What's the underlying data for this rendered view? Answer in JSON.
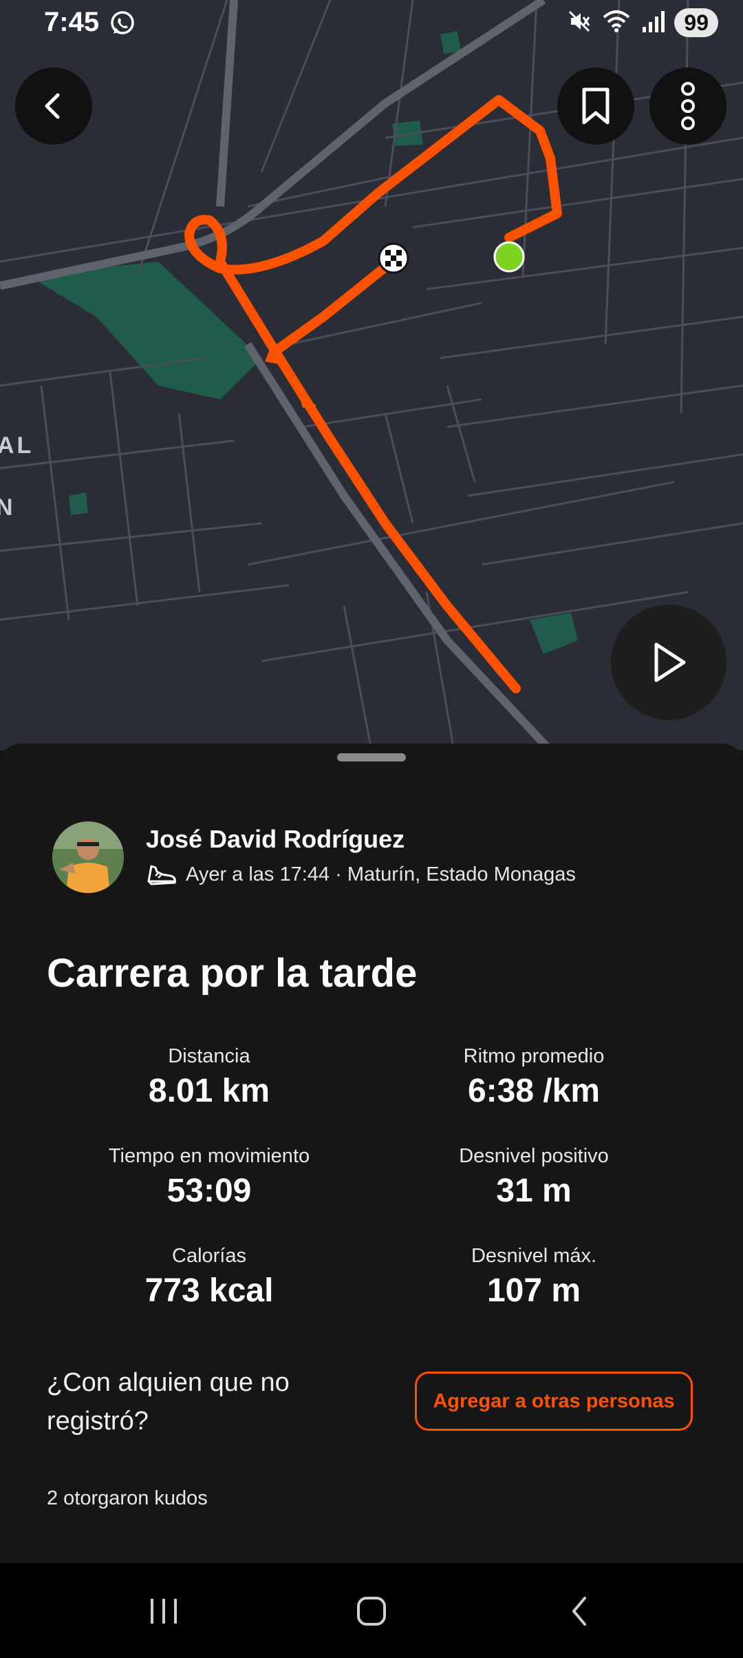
{
  "status_bar": {
    "time": "7:45",
    "battery": "99",
    "icons": [
      "whatsapp-icon",
      "mute-icon",
      "wifi-icon",
      "signal-icon"
    ]
  },
  "map": {
    "labels": [
      "AL",
      "N"
    ],
    "route_color": "#fc5200",
    "start_color": "#7ed321",
    "buttons": [
      "back-icon",
      "bookmark-icon",
      "more-icon",
      "play-icon"
    ]
  },
  "activity": {
    "athlete_name": "José David Rodríguez",
    "meta": "Ayer a las 17:44 · Maturín, Estado Monagas",
    "title": "Carrera por la tarde",
    "stats": [
      {
        "label": "Distancia",
        "value": "8.01 km"
      },
      {
        "label": "Ritmo promedio",
        "value": "6:38 /km"
      },
      {
        "label": "Tiempo en movimiento",
        "value": "53:09"
      },
      {
        "label": "Desnivel positivo",
        "value": "31 m"
      },
      {
        "label": "Calorías",
        "value": "773 kcal"
      },
      {
        "label": "Desnivel máx.",
        "value": "107 m"
      }
    ],
    "question": "¿Con alquien que no registró?",
    "add_button": "Agregar a otras personas",
    "kudos": "2 otorgaron kudos"
  },
  "colors": {
    "accent": "#fc5200",
    "sheet_bg": "#161616",
    "map_bg": "#2a2d36"
  }
}
